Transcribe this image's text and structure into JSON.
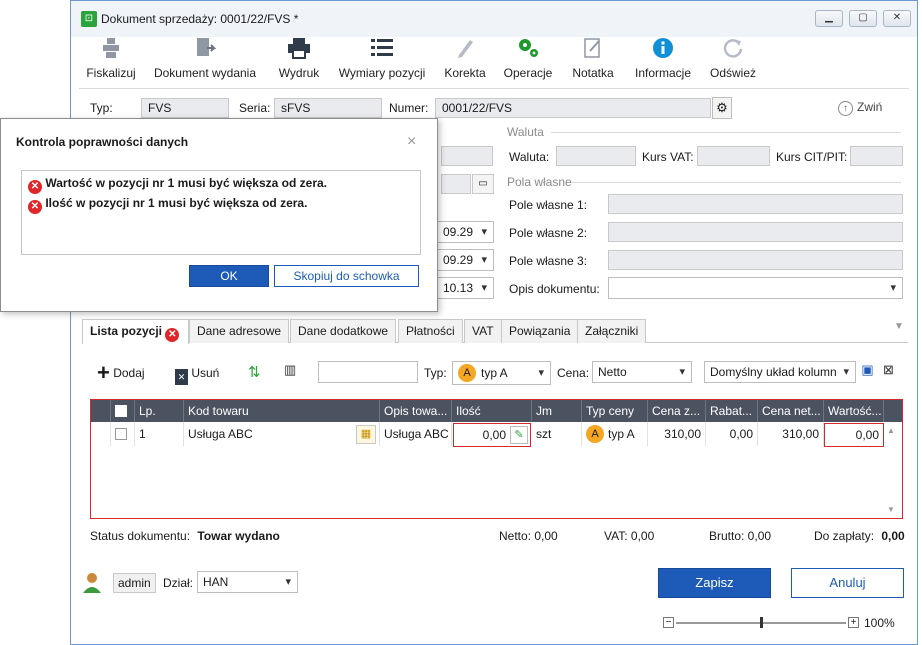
{
  "window": {
    "title": "Dokument sprzedaży: 0001/22/FVS *",
    "minimize": "▁",
    "maximize": "▢",
    "close": "✕"
  },
  "toolbar": {
    "fiskalizuj": "Fiskalizuj",
    "dokument_wydania": "Dokument wydania",
    "wydruk": "Wydruk",
    "wymiary": "Wymiary pozycji",
    "korekta": "Korekta",
    "operacje": "Operacje",
    "notatka": "Notatka",
    "informacje": "Informacje",
    "odswiez": "Odśwież"
  },
  "header": {
    "typ_label": "Typ:",
    "typ_value": "FVS",
    "seria_label": "Seria:",
    "seria_value": "sFVS",
    "numer_label": "Numer:",
    "numer_value": "0001/22/FVS",
    "zwin": "Zwiń"
  },
  "waluta": {
    "section": "Waluta",
    "waluta_label": "Waluta:",
    "waluta_value": "",
    "kurs_vat_label": "Kurs VAT:",
    "kurs_vat_value": "",
    "kurs_cit_label": "Kurs CIT/PIT:",
    "kurs_cit_value": ""
  },
  "pola": {
    "section": "Pola własne",
    "p1_label": "Pole własne 1:",
    "p2_label": "Pole własne 2:",
    "p3_label": "Pole własne 3:",
    "opis_label": "Opis dokumentu:"
  },
  "dates": {
    "d1": "09.29",
    "d2": "09.29",
    "d3": "10.13"
  },
  "tabs": [
    "Lista pozycji",
    "Dane adresowe",
    "Dane dodatkowe",
    "Płatności",
    "VAT",
    "Powiązania",
    "Załączniki"
  ],
  "grid_toolbar": {
    "dodaj": "Dodaj",
    "usun": "Usuń",
    "search_value": "",
    "typ_label": "Typ:",
    "typ_value": "typ A",
    "typ_badge": "A",
    "cena_label": "Cena:",
    "cena_value": "Netto",
    "uklad_value": "Domyślny układ kolumn"
  },
  "grid": {
    "columns": [
      "Lp.",
      "Kod towaru",
      "Opis towa...",
      "Ilość",
      "Jm",
      "Typ ceny",
      "Cena z...",
      "Rabat...",
      "Cena net...",
      "Wartość..."
    ],
    "rows": [
      {
        "lp": "1",
        "kod": "Usługa ABC",
        "opis": "Usługa ABC",
        "ilosc": "0,00",
        "jm": "szt",
        "typ_badge": "A",
        "typ_ceny": "typ A",
        "cena_z": "310,00",
        "rabat": "0,00",
        "cena_net": "310,00",
        "wartosc": "0,00"
      }
    ]
  },
  "status": {
    "label": "Status dokumentu:",
    "value": "Towar wydano",
    "netto": "Netto: 0,00",
    "vat": "VAT: 0,00",
    "brutto": "Brutto: 0,00",
    "do_zaplaty_label": "Do zapłaty:",
    "do_zaplaty_value": "0,00"
  },
  "footer": {
    "user": "admin",
    "dzial_label": "Dział:",
    "dzial_value": "HAN",
    "zapisz": "Zapisz",
    "anuluj": "Anuluj",
    "zoom": "100%",
    "zoom_minus": "−",
    "zoom_plus": "+"
  },
  "dialog": {
    "title": "Kontrola poprawności danych",
    "close": "×",
    "errors": [
      "Wartość w pozycji nr 1 musi być większa od zera.",
      "Ilość w pozycji nr 1 musi być większa od zera."
    ],
    "ok": "OK",
    "copy": "Skopiuj do schowka"
  },
  "colors": {
    "accent": "#1e5bb8",
    "error": "#e0262a",
    "grid_header": "#4b5260",
    "badge": "#f5a623"
  }
}
